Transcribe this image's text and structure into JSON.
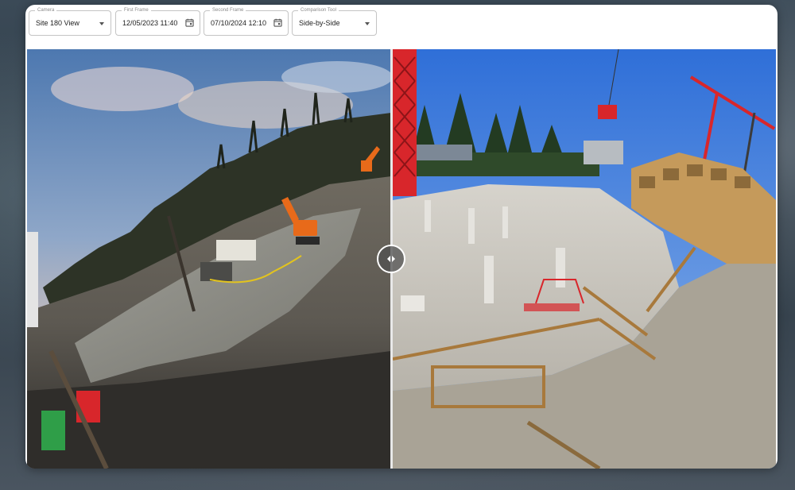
{
  "controls": {
    "camera": {
      "label": "Camera",
      "value": "Site 180 View"
    },
    "first_frame": {
      "label": "First Frame",
      "value": "12/05/2023 11:40"
    },
    "second_frame": {
      "label": "Second Frame",
      "value": "07/10/2024 12:10"
    },
    "comparison_tool": {
      "label": "Comparison Tool",
      "value": "Side-by-Side"
    }
  },
  "icons": {
    "dropdown": "chevron-down-icon",
    "calendar": "calendar-icon",
    "split_handle": "split-handle-icon"
  },
  "colors": {
    "panel": "#ffffff",
    "border": "#c4c4c4",
    "crane_red": "#d8262b",
    "excavator_orange": "#e86a1a"
  }
}
